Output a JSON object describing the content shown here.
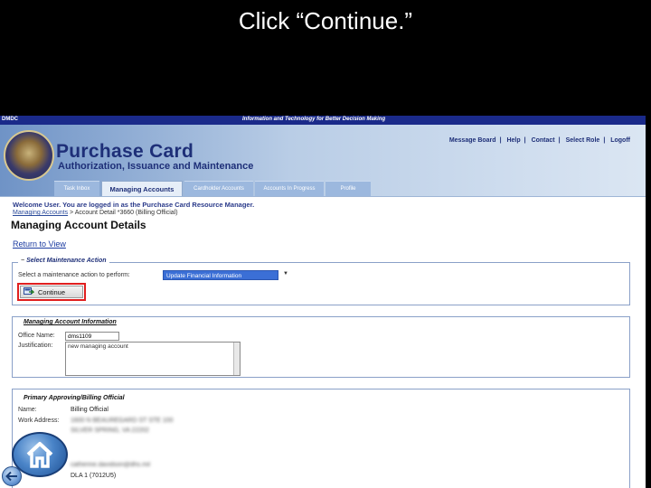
{
  "slide": {
    "title": "Click “Continue.”"
  },
  "topbar": {
    "org": "DMDC",
    "tagline": "Information and Technology for Better Decision Making"
  },
  "header": {
    "title": "Purchase Card",
    "subtitle": "Authorization, Issuance and Maintenance",
    "util_links": [
      "Message Board",
      "Help",
      "Contact",
      "Select Role",
      "Logoff"
    ]
  },
  "tabs": [
    {
      "label": "Task Inbox"
    },
    {
      "label": "Managing Accounts"
    },
    {
      "label": "Cardholder Accounts"
    },
    {
      "label": "Accounts In Progress"
    },
    {
      "label": "Profile"
    }
  ],
  "page": {
    "welcome": "Welcome User. You are logged in as the Purchase Card Resource Manager.",
    "breadcrumb_link": "Managing Accounts",
    "breadcrumb_current": " > Account Detail *3660 (Billing Official)",
    "title": "Managing Account Details",
    "return_link": "Return to View"
  },
  "maintenance": {
    "legend": "Select Maintenance Action",
    "label": "Select a maintenance action to perform:",
    "selected": "Update Financial Information",
    "continue_label": "Continue"
  },
  "account_info": {
    "title": "Managing Account Information",
    "office_label": "Office Name:",
    "office_value": "dms1109",
    "justification_label": "Justification:",
    "justification_value": "new managing account"
  },
  "approver": {
    "title": "Primary Approving/Billing Official",
    "name_label": "Name:",
    "name_value": "Billing Official",
    "work_address_label": "Work Address:",
    "work_address_line1": "1600 N BEAUREGARD ST STE 100",
    "work_address_line2": "SILVER SPRING, VA 22202",
    "email_value": "catherine.davidson@dhs.mil",
    "org_value": "DLA 1 (7012U5)"
  },
  "colors": {
    "accent": "#1e2f78",
    "highlight": "#e01f1f",
    "select": "#3b6fd6"
  },
  "icons": {
    "home": "home-icon",
    "back": "back-arrow-icon",
    "continue": "continue-icon"
  }
}
